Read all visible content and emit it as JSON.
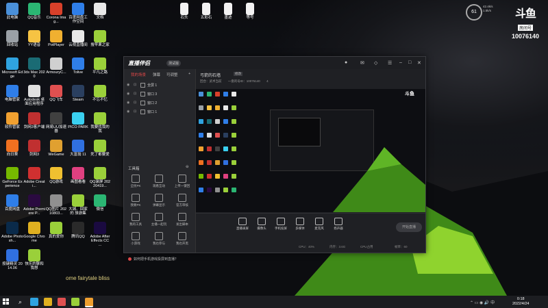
{
  "desktop": {
    "icons": [
      {
        "label": "此电脑",
        "color": "#4a90d9"
      },
      {
        "label": "QQ音乐",
        "color": "#2bb673"
      },
      {
        "label": "Corona Imag...",
        "color": "#d8402a"
      },
      {
        "label": "百度网盘工作空间",
        "color": "#2f7ee8"
      },
      {
        "label": "文档",
        "color": "#e8e8e8"
      },
      {
        "label": "回收站",
        "color": "#9aa0a6"
      },
      {
        "label": "YY语音",
        "color": "#f6c343"
      },
      {
        "label": "PotPlayer",
        "color": "#f0b030"
      },
      {
        "label": "云视直播间",
        "color": "#e8e8e8"
      },
      {
        "label": "搜苹果之家",
        "color": "#9ad03a"
      },
      {
        "label": "Microsoft Edge",
        "color": "#2fa3e0"
      },
      {
        "label": "3ds Max 2020",
        "color": "#1a6b74"
      },
      {
        "label": "ArmouryC...",
        "color": "#d0d0d0"
      },
      {
        "label": "Tolive",
        "color": "#2f7ee8"
      },
      {
        "label": "平凡之路",
        "color": "#9ad03a"
      },
      {
        "label": "电脑管家",
        "color": "#2f7ee8"
      },
      {
        "label": "Autodesk 桌面应用程序",
        "color": "#e0e0e0"
      },
      {
        "label": "QQ飞车",
        "color": "#e05050"
      },
      {
        "label": "Steam",
        "color": "#2a3f5f"
      },
      {
        "label": "不忘不忆",
        "color": "#9ad03a"
      },
      {
        "label": "软件管家",
        "color": "#f0a030"
      },
      {
        "label": "剑网3客户端",
        "color": "#c03030"
      },
      {
        "label": "网易UU加速器",
        "color": "#404040"
      },
      {
        "label": "PICO PARK",
        "color": "#3ad0f0"
      },
      {
        "label": "我要找我的我",
        "color": "#9ad03a"
      },
      {
        "label": "向日葵",
        "color": "#f07020"
      },
      {
        "label": "剑网3",
        "color": "#c03030"
      },
      {
        "label": "WeGame",
        "color": "#e0a030"
      },
      {
        "label": "大富翁 11",
        "color": "#3070e0"
      },
      {
        "label": "死了都要爱",
        "color": "#9ad03a"
      },
      {
        "label": "GeForce Experience",
        "color": "#76b900"
      },
      {
        "label": "Adobe Creati...",
        "color": "#d03030"
      },
      {
        "label": "QQ游戏",
        "color": "#f0c030"
      },
      {
        "label": "画图看看",
        "color": "#e04080"
      },
      {
        "label": "QQ录屏 20220419...",
        "color": "#9ad03a"
      },
      {
        "label": "百度网盘",
        "color": "#2f7ee8"
      },
      {
        "label": "Adobe Premiere P...",
        "color": "#2a0a40"
      },
      {
        "label": "QQ图片 20210803...",
        "color": "#909090"
      },
      {
        "label": "大城、回家的 旅游集",
        "color": "#9ad03a"
      },
      {
        "label": "微信",
        "color": "#2bb673"
      },
      {
        "label": "Adobe Photosh...",
        "color": "#0a2a4a"
      },
      {
        "label": "Google Chrome",
        "color": "#e0b020"
      },
      {
        "label": "真的爱你",
        "color": "#9ad03a"
      },
      {
        "label": "腾讯QQ",
        "color": "#2a2a2a"
      },
      {
        "label": "Adobe After Effects CC ...",
        "color": "#1a0a40"
      },
      {
        "label": "按键精灵 2014.06",
        "color": "#3070e0"
      },
      {
        "label": "快乐的聊和 我想",
        "color": "#9ad03a"
      }
    ],
    "top_files": [
      "石头",
      "五彩石",
      "墨迹",
      "等号"
    ]
  },
  "system": {
    "cpu": "61",
    "net_up": "42.4k/s",
    "net_down": "1.5k/s",
    "room_label": "房间号",
    "room_number": "10076140",
    "clock_time": "0:18",
    "clock_date": "2022/4/24"
  },
  "app": {
    "brand": "直播伴侣",
    "version": "测试版",
    "tabs": [
      "我的场景",
      "弹幕",
      "可调整"
    ],
    "scenes": [
      "全屏 1",
      "窗口 3",
      "窗口 2",
      "窗口 1"
    ],
    "tools_title": "工具箱",
    "tools": [
      {
        "label": "全民PK"
      },
      {
        "label": "观看互动"
      },
      {
        "label": "上传一键回"
      },
      {
        "label": "我要PK"
      },
      {
        "label": "弹幕显示"
      },
      {
        "label": "官方审核"
      },
      {
        "label": "我的工具"
      },
      {
        "label": "主播一起玩"
      },
      {
        "label": "发出脚本"
      },
      {
        "label": "小游戏"
      },
      {
        "label": "我也参与"
      },
      {
        "label": "我也开黑"
      }
    ],
    "hint": "如何把手机游戏投屏到直播？",
    "room_title": "弓箭的石墙",
    "edit": "修改",
    "meta": [
      "回合：武术当前",
      "一盘的号ID：10076140",
      "4"
    ],
    "controls": [
      "直播录屏",
      "摄像头",
      "手机投屏",
      "多媒体",
      "麦克风",
      "扬声器"
    ],
    "go_live": "开始直播",
    "status": [
      "CPU：40%",
      "内存：3.6G",
      "CPU占用",
      "帧率：60"
    ]
  },
  "caption": "ome fairytale bliss"
}
